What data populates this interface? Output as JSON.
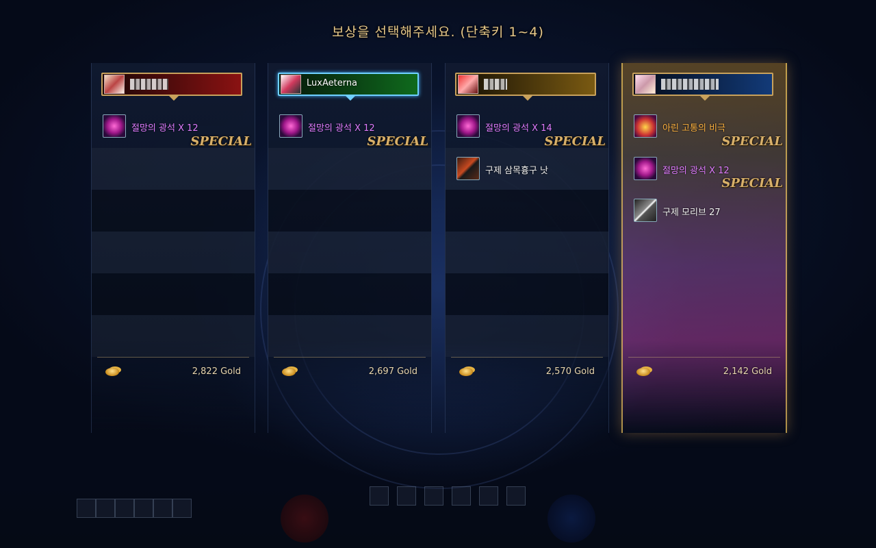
{
  "title": "보상을 선택해주세요. (단축키 1~4)",
  "columns": [
    {
      "header_style": "red",
      "player_name": "",
      "name_obscured": true,
      "portrait": "player-portrait-1",
      "selected": false,
      "highlighted": false,
      "items": [
        {
          "name": "절망의 광석 X 12",
          "icon": "crystal-ore-icon",
          "color": "purple",
          "special": "SPECIAL"
        }
      ],
      "gold": "2,822 Gold"
    },
    {
      "header_style": "green",
      "player_name": "LuxAeterna",
      "name_obscured": false,
      "portrait": "player-portrait-2",
      "selected": false,
      "highlighted": true,
      "items": [
        {
          "name": "절망의 광석 X 12",
          "icon": "crystal-ore-icon",
          "color": "purple",
          "special": "SPECIAL"
        }
      ],
      "gold": "2,697 Gold"
    },
    {
      "header_style": "gold",
      "player_name": "",
      "name_obscured": true,
      "portrait": "player-portrait-3",
      "selected": false,
      "highlighted": false,
      "items": [
        {
          "name": "절망의 광석 X 14",
          "icon": "crystal-ore-icon",
          "color": "purple",
          "special": "SPECIAL"
        },
        {
          "name": "구제 삼목흉구 낫",
          "icon": "scythe-weapon-icon",
          "color": "white",
          "special": ""
        }
      ],
      "gold": "2,570 Gold"
    },
    {
      "header_style": "blue",
      "player_name": "",
      "name_obscured": true,
      "portrait": "player-portrait-4",
      "selected": true,
      "highlighted": false,
      "items": [
        {
          "name": "아린 고통의 비극",
          "icon": "epic-book-icon",
          "color": "orange",
          "special": "SPECIAL"
        },
        {
          "name": "절망의 광석 X 12",
          "icon": "crystal-ore-icon",
          "color": "purple",
          "special": "SPECIAL"
        },
        {
          "name": "구제 모리브 27",
          "icon": "blade-weapon-icon",
          "color": "white",
          "special": ""
        }
      ],
      "gold": "2,142 Gold"
    }
  ],
  "colors": {
    "title": "#e8c98a",
    "frame_gold": "#c9a25c",
    "item_purple": "#e07cff",
    "item_orange": "#ffb340",
    "special_gold": "#d8b06a"
  }
}
